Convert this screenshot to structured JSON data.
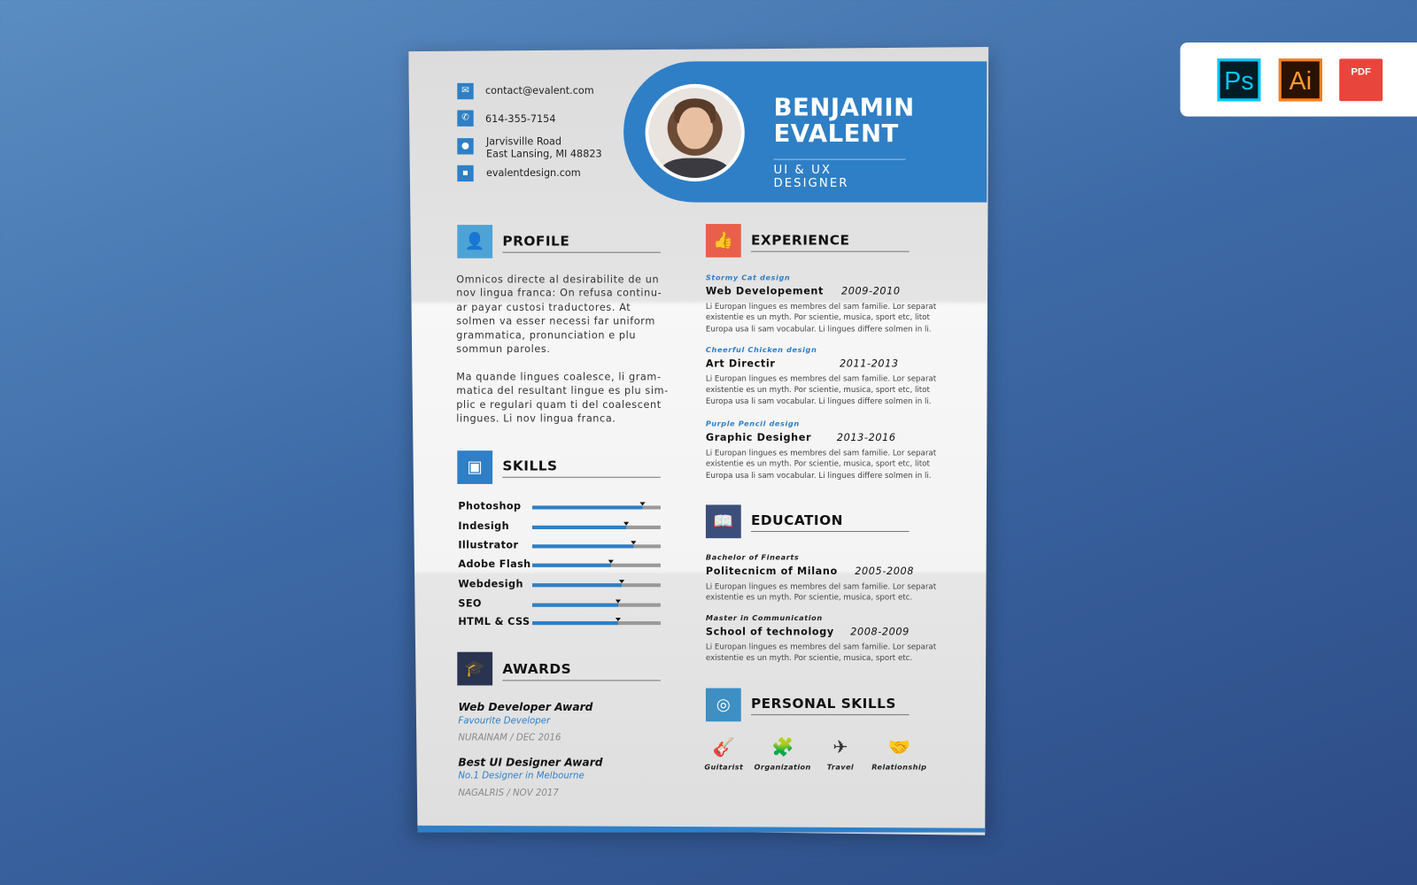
{
  "contact": {
    "email": "contact@evalent.com",
    "phone": "614-355-7154",
    "address_line1": "Jarvisville Road",
    "address_line2": "East Lansing, MI 48823",
    "website": "evalentdesign.com"
  },
  "header": {
    "first_name": "BENJAMIN",
    "last_name": "EVALENT",
    "title": "UI & UX DESIGNER",
    "accent": "#2f7fc6"
  },
  "profile": {
    "heading": "PROFILE",
    "paragraphs": [
      [
        "Omnicos directe al desirabilite de un",
        "nov lingua franca: On refusa continu-",
        "ar payar custosi traductores. At",
        "solmen va esser necessi far uniform",
        "grammatica, pronunciation e plu",
        "sommun paroles."
      ],
      [
        "Ma quande lingues coalesce, li gram-",
        "matica del resultant lingue es plu sim-",
        "plic e regulari quam ti del coalescent",
        "lingues. Li nov lingua franca."
      ]
    ]
  },
  "skills": {
    "heading": "SKILLS",
    "items": [
      {
        "name": "Photoshop",
        "level": 0.86
      },
      {
        "name": "Indesigh",
        "level": 0.73
      },
      {
        "name": "Illustrator",
        "level": 0.79
      },
      {
        "name": "Adobe Flash",
        "level": 0.61
      },
      {
        "name": "Webdesigh",
        "level": 0.7
      },
      {
        "name": "SEO",
        "level": 0.67
      },
      {
        "name": "HTML & CSS",
        "level": 0.67
      }
    ]
  },
  "awards": {
    "heading": "AWARDS",
    "items": [
      {
        "title": "Web Developer Award",
        "subtitle": "Favourite Developer",
        "detail": "NURAINAM / DEC 2016"
      },
      {
        "title": "Best UI Designer Award",
        "subtitle": "No.1 Designer in Melbourne",
        "detail": "NAGALRIS / NOV 2017"
      }
    ]
  },
  "experience": {
    "heading": "EXPERIENCE",
    "items": [
      {
        "company": "Stormy Cat design",
        "role": "Web Developement",
        "years": "2009-2010",
        "desc": [
          "Li Europan lingues es membres del sam familie. Lor separat",
          "existentie es un myth. Por scientie, musica, sport etc, litot",
          "Europa usa li sam vocabular. Li lingues differe solmen in li."
        ]
      },
      {
        "company": "Cheerful Chicken design",
        "role": "Art Directir",
        "years": "2011-2013",
        "desc": [
          "Li Europan lingues es membres del sam familie. Lor separat",
          "existentie es un myth. Por scientie, musica, sport etc, litot",
          "Europa usa li sam vocabular. Li lingues differe solmen in li."
        ]
      },
      {
        "company": "Purple Pencil design",
        "role": "Graphic Desigher",
        "years": "2013-2016",
        "desc": [
          "Li Europan lingues es membres del sam familie. Lor separat",
          "existentie es un myth. Por scientie, musica, sport etc, litot",
          "Europa usa li sam vocabular. Li lingues differe solmen in li."
        ]
      }
    ]
  },
  "education": {
    "heading": "EDUCATION",
    "items": [
      {
        "degree": "Bachelor of Finearts",
        "school": "Politecnicm of Milano",
        "years": "2005-2008",
        "desc": [
          "Li Europan lingues es membres del sam familie. Lor separat",
          "existentie es un myth. Por scientie, musica, sport etc."
        ]
      },
      {
        "degree": "Master in Communication",
        "school": "School of technology",
        "years": "2008-2009",
        "desc": [
          "Li Europan lingues es membres del sam familie. Lor separat",
          "existentie es un myth. Por scientie, musica, sport etc."
        ]
      }
    ]
  },
  "personal_skills": {
    "heading": "PERSONAL SKILLS",
    "items": [
      {
        "label": "Guitarist",
        "icon": "guitar-icon"
      },
      {
        "label": "Organization",
        "icon": "puzzle-icon"
      },
      {
        "label": "Travel",
        "icon": "airplane-icon"
      },
      {
        "label": "Relationship",
        "icon": "handshake-icon"
      }
    ]
  },
  "software_badges": [
    {
      "label": "Ps",
      "icon": "photoshop-icon"
    },
    {
      "label": "Ai",
      "icon": "illustrator-icon"
    },
    {
      "label": "PDF",
      "icon": "pdf-icon"
    }
  ]
}
